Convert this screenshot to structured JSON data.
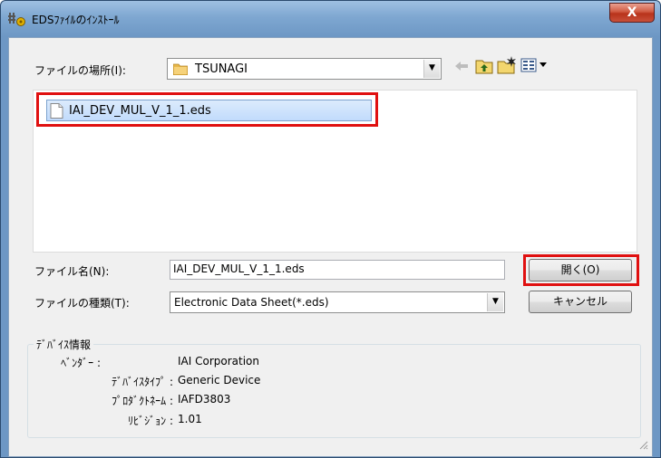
{
  "window": {
    "title": "EDSﾌｧｲﾙのｲﾝｽﾄｰﾙ",
    "close_label": "X"
  },
  "location": {
    "label": "ファイルの場所(I):",
    "value": "TSUNAGI"
  },
  "toolbar": {
    "icons": [
      "back-arrow-icon",
      "up-folder-icon",
      "new-folder-icon",
      "view-menu-icon"
    ]
  },
  "files": [
    {
      "name": "IAI_DEV_MUL_V_1_1.eds",
      "selected": true
    }
  ],
  "filename": {
    "label": "ファイル名(N):",
    "value": "IAI_DEV_MUL_V_1_1.eds"
  },
  "filetype": {
    "label": "ファイルの種類(T):",
    "value": "Electronic Data Sheet(*.eds)"
  },
  "buttons": {
    "open": "開く(O)",
    "cancel": "キャンセル"
  },
  "device_info": {
    "title": "ﾃﾞﾊﾞｲｽ情報",
    "rows": [
      {
        "label": "ﾍﾞﾝﾀﾞｰ :",
        "value": "IAI Corporation"
      },
      {
        "label": "ﾃﾞﾊﾞｲｽﾀｲﾌﾟ :",
        "value": "Generic Device"
      },
      {
        "label": "ﾌﾟﾛﾀﾞｸﾄﾈｰﾑ :",
        "value": "IAFD3803"
      },
      {
        "label": "ﾘﾋﾞｼﾞｮﾝ :",
        "value": "1.01"
      }
    ]
  },
  "colors": {
    "highlight": "#e01010",
    "title_bar": "#6d97c4",
    "close_button": "#c8503a"
  }
}
